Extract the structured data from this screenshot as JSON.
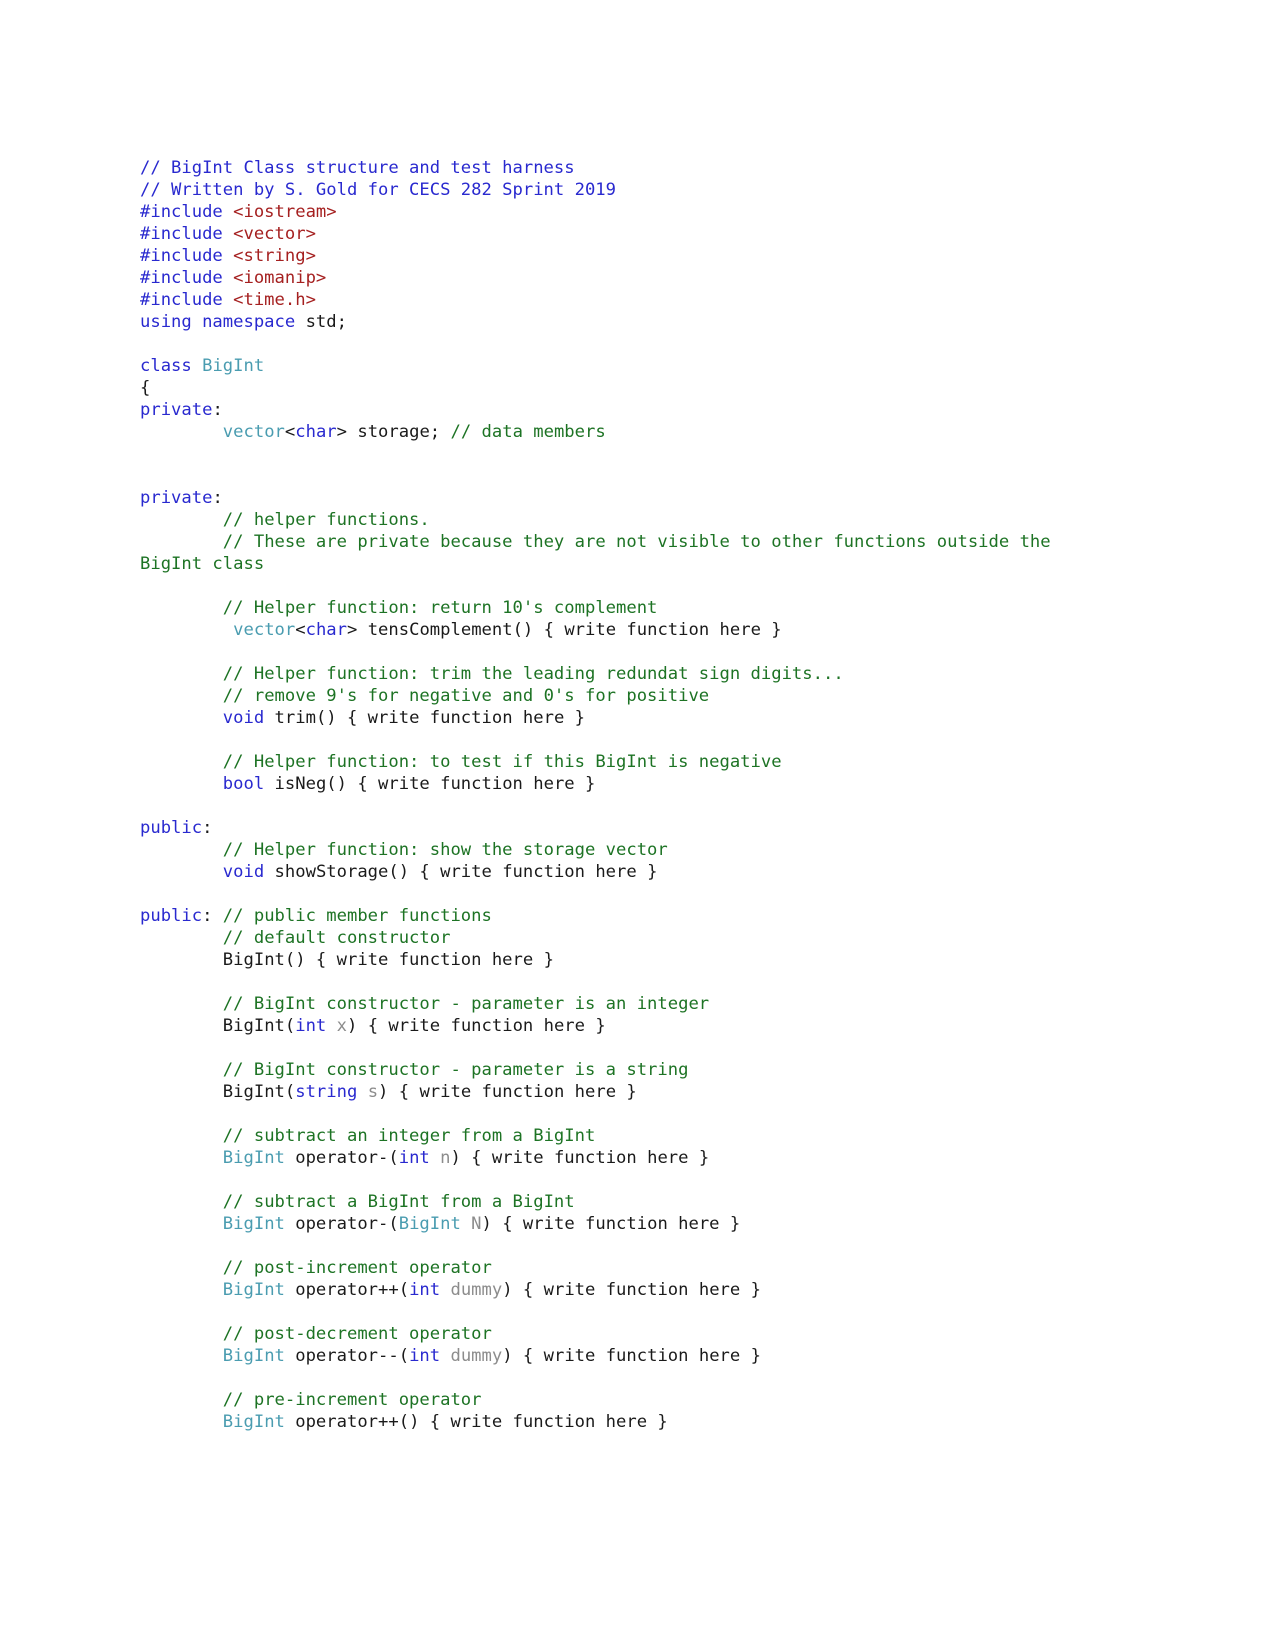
{
  "document": {
    "title": "BigInt Class structure and test harness",
    "language": "C++",
    "colors": {
      "background": "#ffffff",
      "plain": "#1a1a1a",
      "comment": "#1d7324",
      "header_comment": "#2929cf",
      "keyword": "#2929cf",
      "include_header": "#a52020",
      "type": "#4a9cb0",
      "parameter": "#8c8c8c"
    }
  },
  "code_lines": [
    {
      "indent": 0,
      "tokens": [
        {
          "t": "// BigInt Class structure and test harness",
          "c": "cmth"
        }
      ]
    },
    {
      "indent": 0,
      "tokens": [
        {
          "t": "// Written by S. Gold for CECS 282 Sprint 2019",
          "c": "cmth"
        }
      ]
    },
    {
      "indent": 0,
      "tokens": [
        {
          "t": "#include ",
          "c": "kw"
        },
        {
          "t": "<iostream>",
          "c": "hdr"
        }
      ]
    },
    {
      "indent": 0,
      "tokens": [
        {
          "t": "#include ",
          "c": "kw"
        },
        {
          "t": "<vector>",
          "c": "hdr"
        }
      ]
    },
    {
      "indent": 0,
      "tokens": [
        {
          "t": "#include ",
          "c": "kw"
        },
        {
          "t": "<string>",
          "c": "hdr"
        }
      ]
    },
    {
      "indent": 0,
      "tokens": [
        {
          "t": "#include ",
          "c": "kw"
        },
        {
          "t": "<iomanip>",
          "c": "hdr"
        }
      ]
    },
    {
      "indent": 0,
      "tokens": [
        {
          "t": "#include ",
          "c": "kw"
        },
        {
          "t": "<time.h>",
          "c": "hdr"
        }
      ]
    },
    {
      "indent": 0,
      "tokens": [
        {
          "t": "using namespace",
          "c": "kw"
        },
        {
          "t": " std;",
          "c": "pln"
        }
      ]
    },
    {
      "blank": true
    },
    {
      "indent": 0,
      "tokens": [
        {
          "t": "class",
          "c": "kw"
        },
        {
          "t": " ",
          "c": "pln"
        },
        {
          "t": "BigInt",
          "c": "typ"
        }
      ]
    },
    {
      "indent": 0,
      "tokens": [
        {
          "t": "{",
          "c": "pln"
        }
      ]
    },
    {
      "indent": 0,
      "tokens": [
        {
          "t": "private",
          "c": "kw"
        },
        {
          "t": ":",
          "c": "pln"
        }
      ]
    },
    {
      "indent": 1,
      "tokens": [
        {
          "t": "vector",
          "c": "typ"
        },
        {
          "t": "<",
          "c": "pln"
        },
        {
          "t": "char",
          "c": "kw"
        },
        {
          "t": "> storage; ",
          "c": "pln"
        },
        {
          "t": "// data members",
          "c": "cmt"
        }
      ]
    },
    {
      "blank": true
    },
    {
      "blank": true
    },
    {
      "indent": 0,
      "tokens": [
        {
          "t": "private",
          "c": "kw"
        },
        {
          "t": ":",
          "c": "pln"
        }
      ]
    },
    {
      "indent": 1,
      "tokens": [
        {
          "t": "// helper functions.",
          "c": "cmt"
        }
      ]
    },
    {
      "indent": 1,
      "tokens": [
        {
          "t": "// These are private because they are not visible to other functions outside the BigInt class",
          "c": "cmt"
        }
      ]
    },
    {
      "blank": true
    },
    {
      "indent": 1,
      "tokens": [
        {
          "t": "// Helper function: return 10's complement",
          "c": "cmt"
        }
      ]
    },
    {
      "indent": 1,
      "tokens": [
        {
          "t": " ",
          "c": "pln"
        },
        {
          "t": "vector",
          "c": "typ"
        },
        {
          "t": "<",
          "c": "pln"
        },
        {
          "t": "char",
          "c": "kw"
        },
        {
          "t": "> tensComplement() { write function here }",
          "c": "pln"
        }
      ]
    },
    {
      "blank": true
    },
    {
      "indent": 1,
      "tokens": [
        {
          "t": "// Helper function: trim the leading redundat sign digits...",
          "c": "cmt"
        }
      ]
    },
    {
      "indent": 1,
      "tokens": [
        {
          "t": "// remove 9's for negative and 0's for positive",
          "c": "cmt"
        }
      ]
    },
    {
      "indent": 1,
      "tokens": [
        {
          "t": "void",
          "c": "kw"
        },
        {
          "t": " trim() { write function here }",
          "c": "pln"
        }
      ]
    },
    {
      "blank": true
    },
    {
      "indent": 1,
      "tokens": [
        {
          "t": "// Helper function: to test if this BigInt is negative",
          "c": "cmt"
        }
      ]
    },
    {
      "indent": 1,
      "tokens": [
        {
          "t": "bool",
          "c": "kw"
        },
        {
          "t": " isNeg() { write function here }",
          "c": "pln"
        }
      ]
    },
    {
      "blank": true
    },
    {
      "indent": 0,
      "tokens": [
        {
          "t": "public",
          "c": "kw"
        },
        {
          "t": ":",
          "c": "pln"
        }
      ]
    },
    {
      "indent": 1,
      "tokens": [
        {
          "t": "// Helper function: show the storage vector",
          "c": "cmt"
        }
      ]
    },
    {
      "indent": 1,
      "tokens": [
        {
          "t": "void",
          "c": "kw"
        },
        {
          "t": " showStorage() { write function here }",
          "c": "pln"
        }
      ]
    },
    {
      "blank": true
    },
    {
      "indent": 0,
      "tokens": [
        {
          "t": "public",
          "c": "kw"
        },
        {
          "t": ": ",
          "c": "pln"
        },
        {
          "t": "// public member functions",
          "c": "cmt"
        }
      ]
    },
    {
      "indent": 1,
      "tokens": [
        {
          "t": "// default constructor",
          "c": "cmt"
        }
      ]
    },
    {
      "indent": 1,
      "tokens": [
        {
          "t": "BigInt() { write function here }",
          "c": "pln"
        }
      ]
    },
    {
      "blank": true
    },
    {
      "indent": 1,
      "tokens": [
        {
          "t": "// BigInt constructor - parameter is an integer",
          "c": "cmt"
        }
      ]
    },
    {
      "indent": 1,
      "tokens": [
        {
          "t": "BigInt(",
          "c": "pln"
        },
        {
          "t": "int",
          "c": "kw"
        },
        {
          "t": " ",
          "c": "pln"
        },
        {
          "t": "x",
          "c": "par"
        },
        {
          "t": ") { write function here }",
          "c": "pln"
        }
      ]
    },
    {
      "blank": true
    },
    {
      "indent": 1,
      "tokens": [
        {
          "t": "// BigInt constructor - parameter is a string",
          "c": "cmt"
        }
      ]
    },
    {
      "indent": 1,
      "tokens": [
        {
          "t": "BigInt(",
          "c": "pln"
        },
        {
          "t": "string",
          "c": "kw"
        },
        {
          "t": " ",
          "c": "pln"
        },
        {
          "t": "s",
          "c": "par"
        },
        {
          "t": ") { write function here }",
          "c": "pln"
        }
      ]
    },
    {
      "blank": true
    },
    {
      "indent": 1,
      "tokens": [
        {
          "t": "// subtract an integer from a BigInt",
          "c": "cmt"
        }
      ]
    },
    {
      "indent": 1,
      "tokens": [
        {
          "t": "BigInt",
          "c": "typ"
        },
        {
          "t": " operator-(",
          "c": "pln"
        },
        {
          "t": "int",
          "c": "kw"
        },
        {
          "t": " ",
          "c": "pln"
        },
        {
          "t": "n",
          "c": "par"
        },
        {
          "t": ") { write function here }",
          "c": "pln"
        }
      ]
    },
    {
      "blank": true
    },
    {
      "indent": 1,
      "tokens": [
        {
          "t": "// subtract a BigInt from a BigInt",
          "c": "cmt"
        }
      ]
    },
    {
      "indent": 1,
      "tokens": [
        {
          "t": "BigInt",
          "c": "typ"
        },
        {
          "t": " operator-(",
          "c": "pln"
        },
        {
          "t": "BigInt",
          "c": "typ"
        },
        {
          "t": " ",
          "c": "pln"
        },
        {
          "t": "N",
          "c": "par"
        },
        {
          "t": ") { write function here }",
          "c": "pln"
        }
      ]
    },
    {
      "blank": true
    },
    {
      "indent": 1,
      "tokens": [
        {
          "t": "// post-increment operator",
          "c": "cmt"
        }
      ]
    },
    {
      "indent": 1,
      "tokens": [
        {
          "t": "BigInt",
          "c": "typ"
        },
        {
          "t": " operator++(",
          "c": "pln"
        },
        {
          "t": "int",
          "c": "kw"
        },
        {
          "t": " ",
          "c": "pln"
        },
        {
          "t": "dummy",
          "c": "par"
        },
        {
          "t": ") { write function here }",
          "c": "pln"
        }
      ]
    },
    {
      "blank": true
    },
    {
      "indent": 1,
      "tokens": [
        {
          "t": "// post-decrement operator",
          "c": "cmt"
        }
      ]
    },
    {
      "indent": 1,
      "tokens": [
        {
          "t": "BigInt",
          "c": "typ"
        },
        {
          "t": " operator--(",
          "c": "pln"
        },
        {
          "t": "int",
          "c": "kw"
        },
        {
          "t": " ",
          "c": "pln"
        },
        {
          "t": "dummy",
          "c": "par"
        },
        {
          "t": ") { write function here }",
          "c": "pln"
        }
      ]
    },
    {
      "blank": true
    },
    {
      "indent": 1,
      "tokens": [
        {
          "t": "// pre-increment operator",
          "c": "cmt"
        }
      ]
    },
    {
      "indent": 1,
      "tokens": [
        {
          "t": "BigInt",
          "c": "typ"
        },
        {
          "t": " operator++() { write function here }",
          "c": "pln"
        }
      ]
    }
  ]
}
